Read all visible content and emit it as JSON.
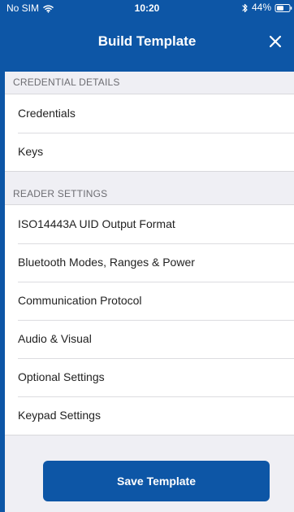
{
  "status_bar": {
    "carrier": "No SIM",
    "time": "10:20",
    "battery_percent": "44%",
    "icons": {
      "wifi": "wifi-icon",
      "bluetooth": "bluetooth-icon",
      "battery": "battery-icon"
    }
  },
  "nav": {
    "title": "Build Template",
    "close_icon": "close-icon"
  },
  "sections": {
    "credential_details": {
      "header": "CREDENTIAL DETAILS",
      "items": [
        {
          "label": "Credentials"
        },
        {
          "label": "Keys"
        }
      ]
    },
    "reader_settings": {
      "header": "READER SETTINGS",
      "items": [
        {
          "label": "ISO14443A UID Output Format"
        },
        {
          "label": "Bluetooth Modes, Ranges & Power"
        },
        {
          "label": "Communication Protocol"
        },
        {
          "label": "Audio & Visual"
        },
        {
          "label": "Optional Settings"
        },
        {
          "label": "Keypad Settings"
        }
      ]
    }
  },
  "footer": {
    "save_label": "Save Template"
  },
  "colors": {
    "accent": "#0d56a6",
    "background": "#efeff4",
    "row_background": "#ffffff",
    "section_text": "#6d6d72",
    "row_text": "#222222"
  }
}
